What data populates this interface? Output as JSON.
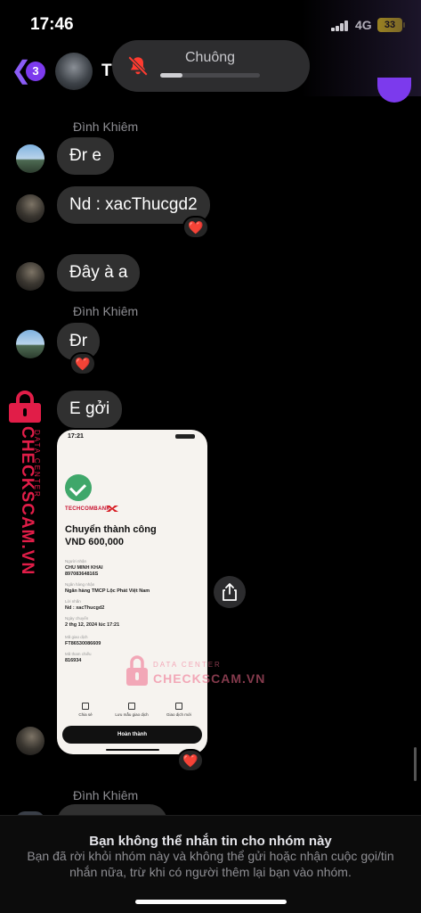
{
  "status_bar": {
    "time": "17:46",
    "network": "4G",
    "battery": "33"
  },
  "header": {
    "unread_count": "3",
    "title_initial": "T"
  },
  "ringer_popup": {
    "label": "Chuông",
    "volume_fraction": 0.22
  },
  "messages": [
    {
      "sender": "Đình Khiêm"
    },
    {
      "text": "Đr e"
    },
    {
      "text": "Nd : xacThucgd2",
      "reaction": "❤️"
    },
    {
      "text": "Đây à a"
    },
    {
      "sender": "Đình Khiêm"
    },
    {
      "text": "Đr",
      "reaction": "❤️"
    },
    {
      "text": "E gởi"
    },
    {
      "sender": "Đình Khiêm"
    }
  ],
  "receipt": {
    "time": "17:21",
    "bank": "TECHCOMBANK",
    "title": "Chuyển thành công",
    "amount": "VND 600,000",
    "fields": [
      {
        "label": "Người nhận",
        "value": "CHU MINH KHAI"
      },
      {
        "label": "",
        "value": "89708364816S"
      },
      {
        "label": "Ngân hàng nhận",
        "value": "Ngân hàng TMCP Lộc Phát Việt Nam"
      },
      {
        "label": "Lời nhắn",
        "value": "Nd : xacThucgd2"
      },
      {
        "label": "Ngày chuyển",
        "value": "2 thg 12, 2024 lúc 17:21"
      },
      {
        "label": "Mã giao dịch",
        "value": "FT86530086609"
      },
      {
        "label": "Mã tham chiếu",
        "value": "816934"
      }
    ],
    "actions": [
      "Chia sẻ",
      "Lưu mẫu giao dịch",
      "Giao dịch mới"
    ],
    "done_label": "Hoàn thành",
    "reaction": "❤️"
  },
  "watermark": {
    "brand": "CHECKSCAM.VN",
    "subtitle": "DATA CENTER"
  },
  "footer": {
    "title": "Bạn không thể nhắn tin cho nhóm này",
    "text": "Bạn đã rời khỏi nhóm này và không thể gửi hoặc nhận cuộc gọi/tin nhắn nữa, trừ khi có người thêm lại bạn vào nhóm."
  },
  "colors": {
    "accent": "#7c3aed",
    "bubble": "#303030",
    "watermark": "#e11d48",
    "success": "#3fa76a"
  },
  "icons": [
    "back-chevron-icon",
    "bell-slash-icon",
    "share-icon",
    "heart-icon",
    "lock-icon",
    "checkmark-icon"
  ]
}
